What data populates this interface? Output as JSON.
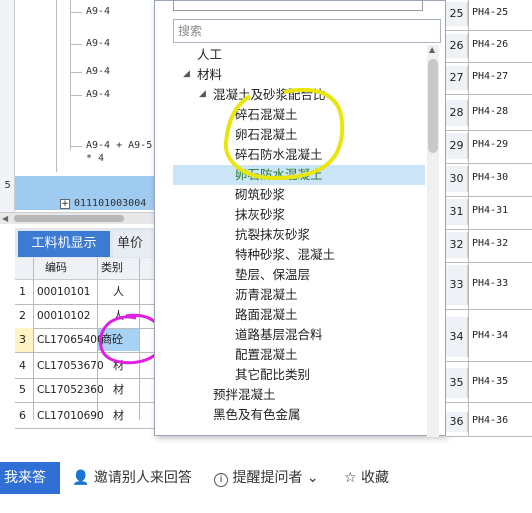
{
  "formula_panel": {
    "rows": [
      "A9-4",
      "A9-4",
      "A9-4",
      "A9-4",
      "A9-4 + A9-5",
      "* 4"
    ],
    "row_number": "5",
    "code_row": "011101003004"
  },
  "tabs": {
    "active": "工料机显示",
    "inactive": "单价"
  },
  "grid": {
    "headers": [
      "编码",
      "类别"
    ],
    "rows": [
      {
        "n": "1",
        "code": "00010101",
        "type": "人"
      },
      {
        "n": "2",
        "code": "00010102",
        "type": "人"
      },
      {
        "n": "3",
        "code": "CL17065400",
        "type": "商砼"
      },
      {
        "n": "4",
        "code": "CL17053670",
        "type": "材"
      },
      {
        "n": "5",
        "code": "CL17052360",
        "type": "材"
      },
      {
        "n": "6",
        "code": "CL17010690",
        "type": "材"
      }
    ]
  },
  "dialog": {
    "search_placeholder": "搜索",
    "tree": [
      {
        "label": "人工",
        "level": 0,
        "toggle": ""
      },
      {
        "label": "材料",
        "level": 0,
        "toggle": "◢"
      },
      {
        "label": "混凝土及砂浆配合比",
        "level": 1,
        "toggle": "◢"
      },
      {
        "label": "碎石混凝土",
        "level": 2,
        "toggle": ""
      },
      {
        "label": "卵石混凝土",
        "level": 2,
        "toggle": ""
      },
      {
        "label": "碎石防水混凝土",
        "level": 2,
        "toggle": ""
      },
      {
        "label": "卵石防水混凝土",
        "level": 2,
        "toggle": "",
        "selected": true
      },
      {
        "label": "砌筑砂浆",
        "level": 2,
        "toggle": ""
      },
      {
        "label": "抹灰砂浆",
        "level": 2,
        "toggle": ""
      },
      {
        "label": "抗裂抹灰砂浆",
        "level": 2,
        "toggle": ""
      },
      {
        "label": "特种砂浆、混凝土",
        "level": 2,
        "toggle": ""
      },
      {
        "label": "垫层、保温层",
        "level": 2,
        "toggle": ""
      },
      {
        "label": "沥青混凝土",
        "level": 2,
        "toggle": ""
      },
      {
        "label": "路面混凝土",
        "level": 2,
        "toggle": ""
      },
      {
        "label": "道路基层混合料",
        "level": 2,
        "toggle": ""
      },
      {
        "label": "配置混凝土",
        "level": 2,
        "toggle": ""
      },
      {
        "label": "其它配比类别",
        "level": 2,
        "toggle": ""
      },
      {
        "label": "预拌混凝土",
        "level": 1,
        "toggle": ""
      },
      {
        "label": "黑色及有色金属",
        "level": 1,
        "toggle": ""
      }
    ],
    "colors": {
      "selected_bg": "#cce4f7",
      "selected_text": "#2b7a2b",
      "highlight_yellow": "#e8e60a"
    }
  },
  "right_list": [
    {
      "n": "25",
      "code": "PH4-25"
    },
    {
      "n": "26",
      "code": "PH4-26"
    },
    {
      "n": "27",
      "code": "PH4-27"
    },
    {
      "n": "28",
      "code": "PH4-28"
    },
    {
      "n": "29",
      "code": "PH4-29"
    },
    {
      "n": "30",
      "code": "PH4-30"
    },
    {
      "n": "31",
      "code": "PH4-31"
    },
    {
      "n": "32",
      "code": "PH4-32"
    },
    {
      "n": "33",
      "code": "PH4-33"
    },
    {
      "n": "34",
      "code": "PH4-34"
    },
    {
      "n": "35",
      "code": "PH4-35"
    },
    {
      "n": "36",
      "code": "PH4-36"
    }
  ],
  "bottom_bar": {
    "answer": "我来答",
    "invite": "邀请别人来回答",
    "remind": "提醒提问者",
    "collect": "收藏"
  },
  "annotations": {
    "pink": "#e020e0"
  }
}
